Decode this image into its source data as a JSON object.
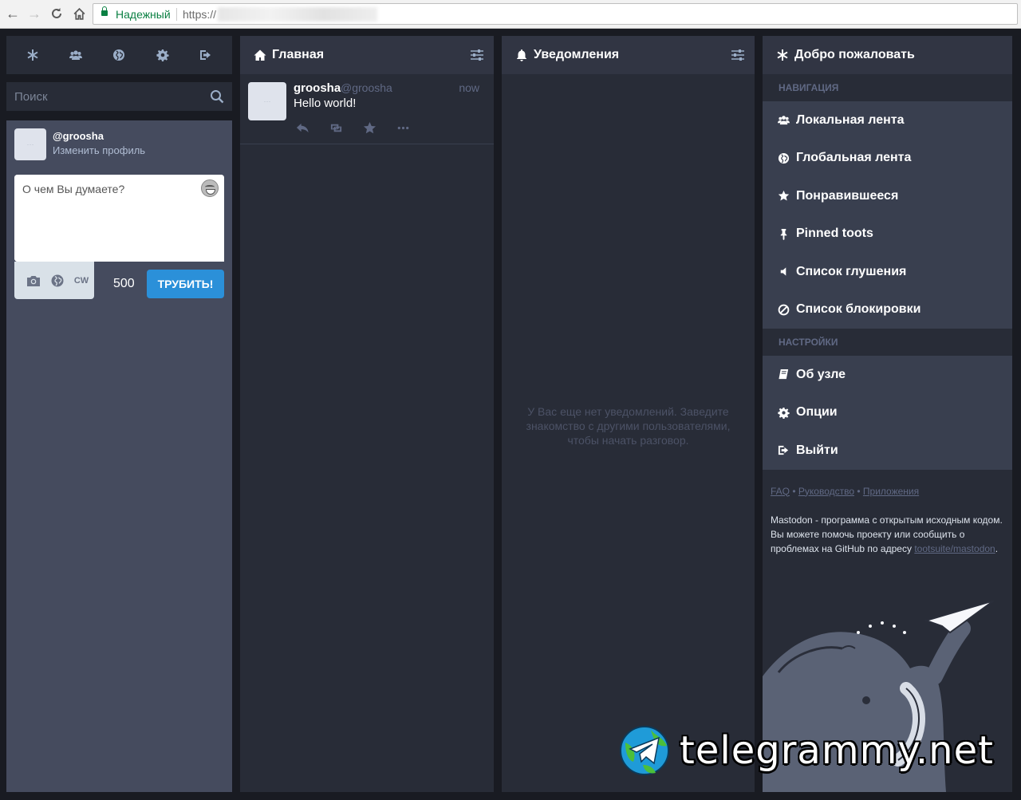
{
  "browser": {
    "secure_label": "Надежный",
    "url_prefix": "https://"
  },
  "drawer": {
    "tabs": [
      "getting-started",
      "local-timeline",
      "federated-timeline",
      "preferences",
      "logout"
    ],
    "search_placeholder": "Поиск",
    "account": {
      "display": "@groosha",
      "edit_profile": "Изменить профиль"
    },
    "compose": {
      "placeholder": "О чем Вы думаете?",
      "cw_label": "CW",
      "char_count": "500",
      "toot_label": "ТРУБИТЬ!"
    }
  },
  "home": {
    "title": "Главная",
    "status": {
      "name": "groosha",
      "handle": "@groosha",
      "time": "now",
      "content": "Hello world!"
    }
  },
  "notifications": {
    "title": "Уведомления",
    "empty": "У Вас еще нет уведомлений. Заведите знакомство с другими пользователями, чтобы начать разговор."
  },
  "getting_started": {
    "title": "Добро пожаловать",
    "nav_heading": "НАВИГАЦИЯ",
    "nav_items": [
      {
        "label": "Локальная лента",
        "icon": "users-icon"
      },
      {
        "label": "Глобальная лента",
        "icon": "globe-icon"
      },
      {
        "label": "Понравившееся",
        "icon": "star-icon"
      },
      {
        "label": "Pinned toots",
        "icon": "thumbtack-icon"
      },
      {
        "label": "Список глушения",
        "icon": "volume-off-icon"
      },
      {
        "label": "Список блокировки",
        "icon": "ban-icon"
      }
    ],
    "settings_heading": "НАСТРОЙКИ",
    "settings_items": [
      {
        "label": "Об узле",
        "icon": "book-icon"
      },
      {
        "label": "Опции",
        "icon": "gear-icon"
      },
      {
        "label": "Выйти",
        "icon": "sign-out-icon"
      }
    ],
    "links": {
      "faq": "FAQ",
      "guide": "Руководство",
      "apps": "Приложения",
      "separator": "•"
    },
    "about": "Mastodon - программа с открытым исходным кодом. Вы можете помочь проекту или сообщить о проблемах на GitHub по адресу",
    "repo": "tootsuite/mastodon",
    "repo_suffix": "."
  },
  "watermark": "telegrammy.net",
  "colors": {
    "bg": "#191b22",
    "column": "#282c37",
    "header": "#313543",
    "item": "#393f4f",
    "compose": "#454b5e",
    "accent": "#2b90d9",
    "muted": "#606984"
  }
}
